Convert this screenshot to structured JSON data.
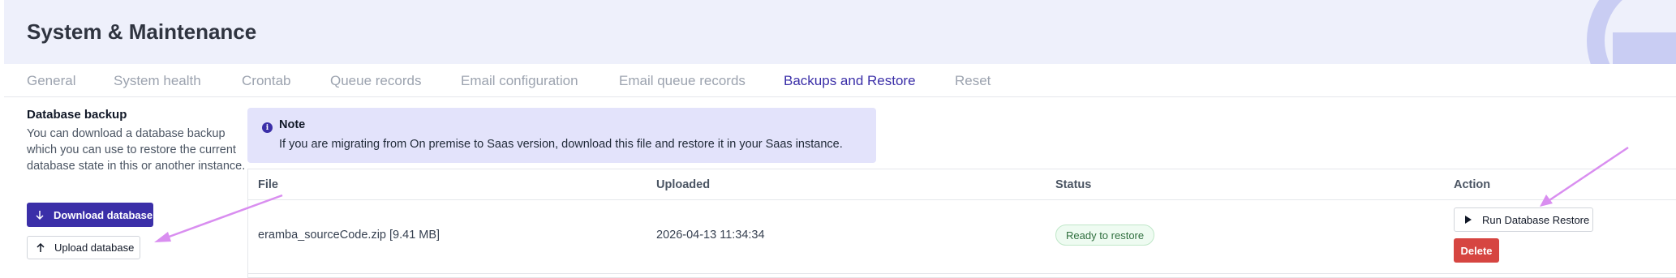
{
  "header": {
    "title": "System & Maintenance"
  },
  "tabs": [
    {
      "label": "General"
    },
    {
      "label": "System health"
    },
    {
      "label": "Crontab"
    },
    {
      "label": "Queue records"
    },
    {
      "label": "Email configuration"
    },
    {
      "label": "Email queue records"
    },
    {
      "label": "Backups and Restore",
      "active": true
    },
    {
      "label": "Reset"
    }
  ],
  "backup_panel": {
    "title": "Database backup",
    "description": "You can download a database backup which you can use to restore the current database state in this or another instance.",
    "download_label": "Download database",
    "upload_label": "Upload database"
  },
  "note": {
    "icon": "info-icon",
    "title": "Note",
    "text": "If you are migrating from On premise to Saas version, download this file and restore it in your Saas instance."
  },
  "table": {
    "columns": [
      "File",
      "Uploaded",
      "Status",
      "Action"
    ],
    "rows": [
      {
        "file": "eramba_sourceCode.zip [9.41 MB]",
        "uploaded": "2026-04-13 11:34:34",
        "status": "Ready to restore",
        "run_label": "Run Database Restore",
        "delete_label": "Delete"
      }
    ]
  },
  "colors": {
    "accent": "#3b2fa8",
    "header_bg": "#eef0fb",
    "note_bg": "#e3e3fb",
    "status_green": "#2f6f3e",
    "danger": "#d64541",
    "annotation_arrow": "#d98ef0"
  }
}
